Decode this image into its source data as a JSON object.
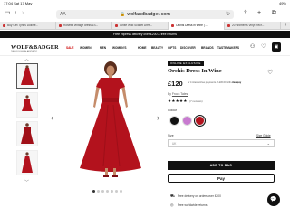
{
  "status_bar": {
    "time": "17:04  Sat 17 May",
    "battery": "49%"
  },
  "browser": {
    "url": "wolfandbadger.com",
    "reader_label": "AA",
    "tabs": [
      {
        "label": "Buy Get Tynes Dolline..."
      },
      {
        "label": "Rosetta vintage dress 1S..."
      },
      {
        "label": "White Wild Scarlet Dres..."
      },
      {
        "label": "Orchis Dress in Wine | ..."
      },
      {
        "label": "20 Women's Vinyl Recr..."
      }
    ],
    "active_tab": 3
  },
  "promo": {
    "text": "Free express delivery over £200 & free returns"
  },
  "site": {
    "logo": "WOLF&BADGER",
    "logo_sub": "THE ECOLOGICAL AESTHETIC",
    "nav": [
      "SALE",
      "WOMEN",
      "MEN",
      "WOMEN'S",
      "HOME",
      "BEAUTY",
      "GIFTS",
      "DISCOVER",
      "BRANDS",
      "TASTEMAKERS"
    ]
  },
  "product": {
    "badge": "ONLINE EXCLUSIVE",
    "title": "Orchis Dress In Wine",
    "price": "£120",
    "clearpay_text": "or 4 interest-free payments of £30.00 with",
    "clearpay_brand": "clearpay",
    "brand_prefix": "By",
    "brand_name": "Frock Tales",
    "stars": "★★★★★",
    "reviews": "(7 reviews)",
    "colour_label": "Colour",
    "colours": [
      "#111111",
      "#c87ad0",
      "#b3121d"
    ],
    "selected_colour": 2,
    "size_label": "Size",
    "size_guide": "Size Guide",
    "size_value": "UK",
    "add_to_bag": "ADD TO BAG",
    "apple_pay": " Pay",
    "info": [
      {
        "icon": "truck-icon",
        "text": "Free delivery on orders over £200"
      },
      {
        "icon": "globe-icon",
        "text": "Free worldwide returns"
      }
    ],
    "gallery_dot_count": 7,
    "active_dot": 0
  },
  "colors": {
    "dress": "#b3121d",
    "accent_dark": "#111111"
  }
}
